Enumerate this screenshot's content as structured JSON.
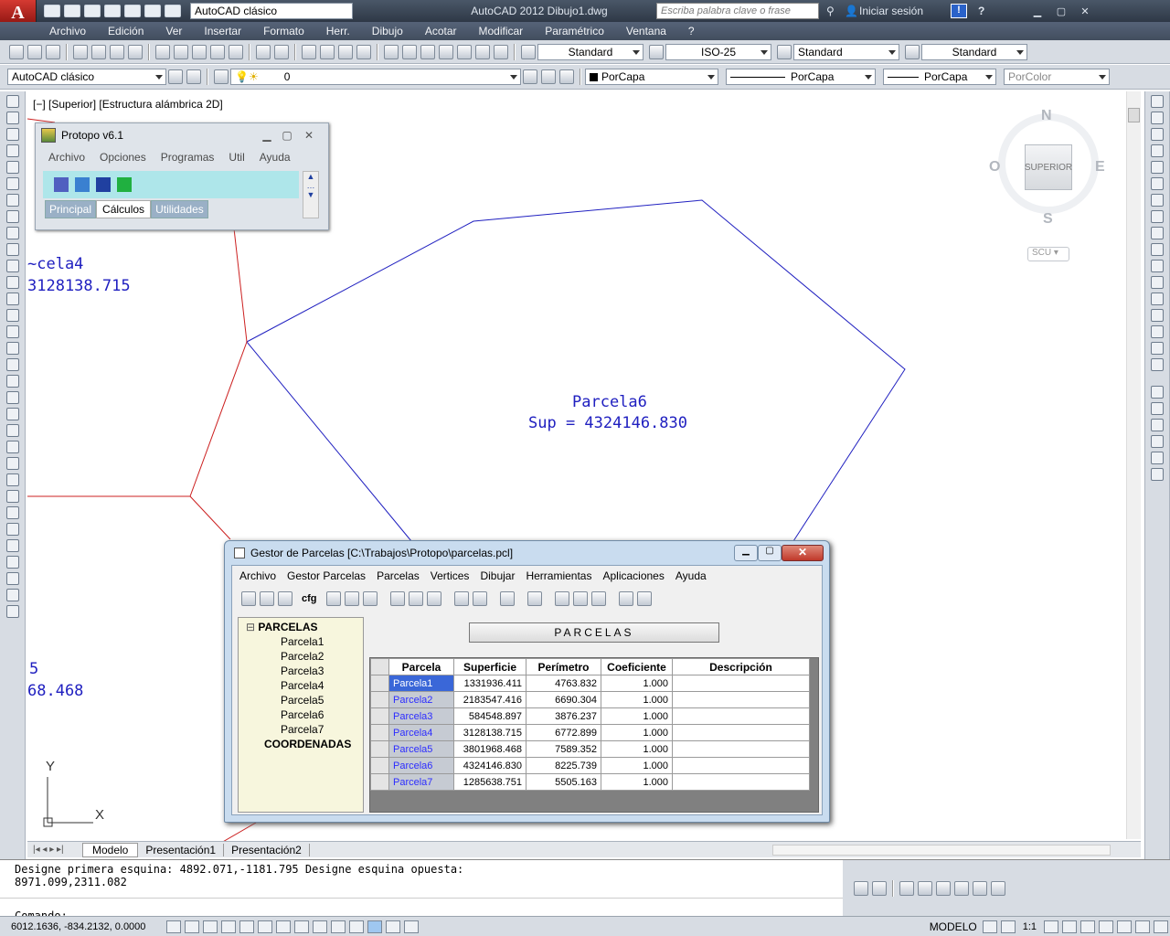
{
  "app": {
    "title": "AutoCAD 2012   Dibujo1.dwg",
    "workspace": "AutoCAD clásico",
    "search_placeholder": "Escriba palabra clave o frase",
    "login": "Iniciar sesión"
  },
  "menu": [
    "Archivo",
    "Edición",
    "Ver",
    "Insertar",
    "Formato",
    "Herr.",
    "Dibujo",
    "Acotar",
    "Modificar",
    "Paramétrico",
    "Ventana",
    "?"
  ],
  "styles": {
    "text_style": "Standard",
    "dim_style": "ISO-25",
    "table_style": "Standard",
    "mleader_style": "Standard"
  },
  "layers": {
    "workspace2": "AutoCAD clásico",
    "layer": "0",
    "color": "PorCapa",
    "linetype": "PorCapa",
    "lineweight": "PorCapa",
    "plotstyle": "PorColor"
  },
  "viewport": {
    "label": "[−] [Superior] [Estructura alámbrica 2D]"
  },
  "viewcube": {
    "north": "N",
    "south": "S",
    "east": "E",
    "west": "O",
    "face": "SUPERIOR",
    "ucs": "SCU"
  },
  "drawing": {
    "p6_name": "Parcela6",
    "p6_area": "Sup = 4324146.830",
    "p4_name": "~cela4",
    "p4_area": "3128138.715",
    "p5_name": "5",
    "p5_area": "68.468",
    "ucs_x": "X",
    "ucs_y": "Y"
  },
  "protopo": {
    "title": "Protopo v6.1",
    "menu": [
      "Archivo",
      "Opciones",
      "Programas",
      "Util",
      "Ayuda"
    ],
    "tabs": [
      "Principal",
      "Cálculos",
      "Utilidades"
    ]
  },
  "gestor": {
    "title": "Gestor de Parcelas [C:\\Trabajos\\Protopo\\parcelas.pcl]",
    "menu": [
      "Archivo",
      "Gestor Parcelas",
      "Parcelas",
      "Vertices",
      "Dibujar",
      "Herramientas",
      "Aplicaciones",
      "Ayuda"
    ],
    "cfg": "cfg",
    "header_button": "PARCELAS",
    "tree_root": "PARCELAS",
    "tree_items": [
      "Parcela1",
      "Parcela2",
      "Parcela3",
      "Parcela4",
      "Parcela5",
      "Parcela6",
      "Parcela7"
    ],
    "tree_root2": "COORDENADAS",
    "columns": [
      "Parcela",
      "Superficie",
      "Perímetro",
      "Coeficiente",
      "Descripción"
    ],
    "rows": [
      [
        "Parcela1",
        "1331936.411",
        "4763.832",
        "1.000",
        ""
      ],
      [
        "Parcela2",
        "2183547.416",
        "6690.304",
        "1.000",
        ""
      ],
      [
        "Parcela3",
        "584548.897",
        "3876.237",
        "1.000",
        ""
      ],
      [
        "Parcela4",
        "3128138.715",
        "6772.899",
        "1.000",
        ""
      ],
      [
        "Parcela5",
        "3801968.468",
        "7589.352",
        "1.000",
        ""
      ],
      [
        "Parcela6",
        "4324146.830",
        "8225.739",
        "1.000",
        ""
      ],
      [
        "Parcela7",
        "1285638.751",
        "5505.163",
        "1.000",
        ""
      ]
    ]
  },
  "layout_tabs": [
    "Modelo",
    "Presentación1",
    "Presentación2"
  ],
  "command": {
    "line1": "Designe primera esquina: 4892.071,-1181.795 Designe esquina opuesta:",
    "line2": "8971.099,2311.082",
    "prompt": "Comando:"
  },
  "status": {
    "coords": "6012.1636, -834.2132, 0.0000",
    "space": "MODELO",
    "scale": "1:1"
  },
  "colors": {
    "title_bg": "#3a4454",
    "accent_red": "#c0302a",
    "parcel_blue": "#2020c0",
    "parcel_red": "#cc2020",
    "grid_select": "#3a67d8"
  }
}
